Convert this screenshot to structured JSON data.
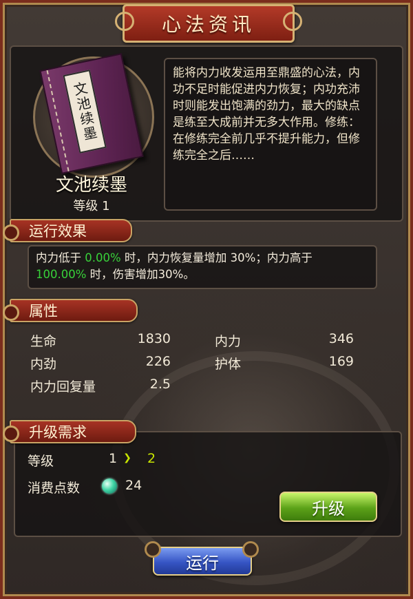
{
  "title": "心法资讯",
  "skill": {
    "book_label": "文池续墨",
    "name": "文池续墨",
    "level_label": "等级 1",
    "description": "能将内力收发运用至鼎盛的心法，内功不足时能促进内力恢复；内功充沛时则能发出饱满的劲力，最大的缺点是练至大成前并无多大作用。修练：在修练完全前几乎不提升能力，但修练完全之后……"
  },
  "effect": {
    "header": "运行效果",
    "part1": "内力低于 ",
    "low_pct": "0.00%",
    "part2": " 时，内力恢复量增加 30%；内力高于",
    "high_pct": "100.00%",
    "part3": " 时，伤害增加30%。"
  },
  "attributes": {
    "header": "属性",
    "items": [
      {
        "label": "生命",
        "value": "1830"
      },
      {
        "label": "内力",
        "value": "346"
      },
      {
        "label": "内劲",
        "value": "226"
      },
      {
        "label": "护体",
        "value": "169"
      },
      {
        "label": "内力回复量",
        "value": "2.5"
      }
    ]
  },
  "upgrade": {
    "header": "升级需求",
    "level_label": "等级",
    "level_from": "1",
    "level_to": "2",
    "cost_label": "消费点数",
    "cost_value": "24",
    "upgrade_button": "升级"
  },
  "run_button": "运行",
  "colors": {
    "accent_red": "#8e2516",
    "gold_border": "#c9a465",
    "highlight_green": "#38d23a",
    "button_green": "#5ca218",
    "button_blue": "#3655c4"
  },
  "icons": [
    "book-icon",
    "arrow-right-icon",
    "gem-icon"
  ]
}
